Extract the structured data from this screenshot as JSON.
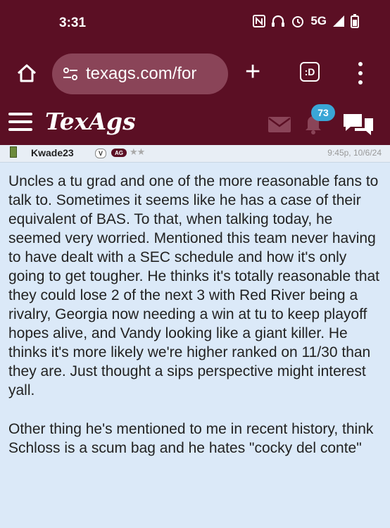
{
  "status_bar": {
    "time": "3:31",
    "network": "5G"
  },
  "browser": {
    "url": "texags.com/for",
    "tabs_label": ":D"
  },
  "site": {
    "logo": "TexAgs",
    "notification_count": "73"
  },
  "post": {
    "username": "Kwade23",
    "verified_badge": "V",
    "school_badge": "AG",
    "rating_stars": "★★",
    "timestamp": "9:45p, 10/6/24",
    "paragraph1": "Uncles a tu grad and one of the more reasonable fans to talk to. Sometimes it seems like he has a case of their equivalent of BAS. To that, when talking today, he seemed very worried. Mentioned this team never having to have dealt with a SEC schedule and how it's only going to get tougher. He thinks it's totally reasonable that they could lose 2 of the next 3 with Red River being a rivalry, Georgia now needing a win at tu to keep playoff hopes alive, and Vandy looking like a giant killer. He thinks it's more likely we're higher ranked on 11/30 than they are. Just thought a sips perspective might interest yall.",
    "paragraph2": "Other thing he's mentioned to me in recent history, think Schloss is a scum bag and he hates \"cocky del conte\""
  },
  "colors": {
    "maroon": "#5b0f24",
    "post_background": "#dbe9f8",
    "badge_blue": "#3aa6d6"
  }
}
